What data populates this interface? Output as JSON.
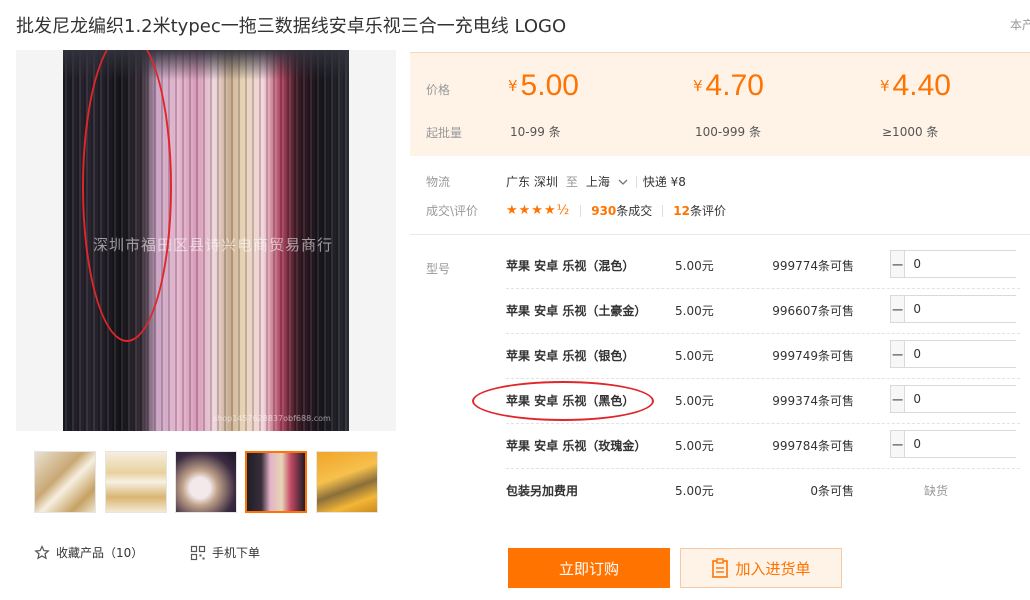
{
  "product": {
    "title": "批发尼龙编织1.2米typec一拖三数据线安卓乐视三合一充电线 LOGO",
    "title_right_fragment": "本产"
  },
  "gallery": {
    "watermark": "深圳市福田区县诗兴电商贸易商行",
    "watermark_small": "shop1457628837obf688.com",
    "thumbnails": [
      {
        "name": "thumb-1-gold-cable"
      },
      {
        "name": "thumb-2-gold-box"
      },
      {
        "name": "thumb-3-coiled-cable"
      },
      {
        "name": "thumb-4-hanging-cables",
        "active": true
      },
      {
        "name": "thumb-5-packaging"
      }
    ],
    "favorite_label": "收藏产品（10）",
    "mobile_label": "手机下单"
  },
  "pricing": {
    "price_label": "价格",
    "moq_label": "起批量",
    "currency": "¥",
    "tiers": [
      {
        "price": "5.00",
        "range": "10-99 条"
      },
      {
        "price": "4.70",
        "range": "100-999 条"
      },
      {
        "price": "4.40",
        "range": "≥1000 条"
      }
    ]
  },
  "logistics": {
    "label": "物流",
    "from": "广东 深圳",
    "to_word": "至",
    "to": "上海",
    "shipping": "快递 ¥8"
  },
  "reviews": {
    "label": "成交\\评价",
    "rating": 4.5,
    "stars": "★★★★½",
    "deals_count": "930",
    "deals_suffix": "条成交",
    "review_count": "12",
    "review_suffix": "条评价"
  },
  "sku": {
    "label": "型号",
    "rows": [
      {
        "name": "苹果 安卓 乐视（混色）",
        "price": "5.00元",
        "stock": "999774条可售",
        "qty": "0"
      },
      {
        "name": "苹果 安卓 乐视（土豪金）",
        "price": "5.00元",
        "stock": "996607条可售",
        "qty": "0"
      },
      {
        "name": "苹果 安卓 乐视（银色）",
        "price": "5.00元",
        "stock": "999749条可售",
        "qty": "0"
      },
      {
        "name": "苹果 安卓 乐视（黑色）",
        "price": "5.00元",
        "stock": "999374条可售",
        "qty": "0"
      },
      {
        "name": "苹果 安卓 乐视（玫瑰金）",
        "price": "5.00元",
        "stock": "999784条可售",
        "qty": "0"
      },
      {
        "name": "包装另加费用",
        "price": "5.00元",
        "stock": "0条可售",
        "status": "缺货"
      }
    ]
  },
  "actions": {
    "buy_now": "立即订购",
    "add_to_cart": "加入进货单"
  },
  "colors": {
    "accent": "#ff7300",
    "annotation_red": "#e0262b",
    "price_bg": "#fff3e8"
  }
}
